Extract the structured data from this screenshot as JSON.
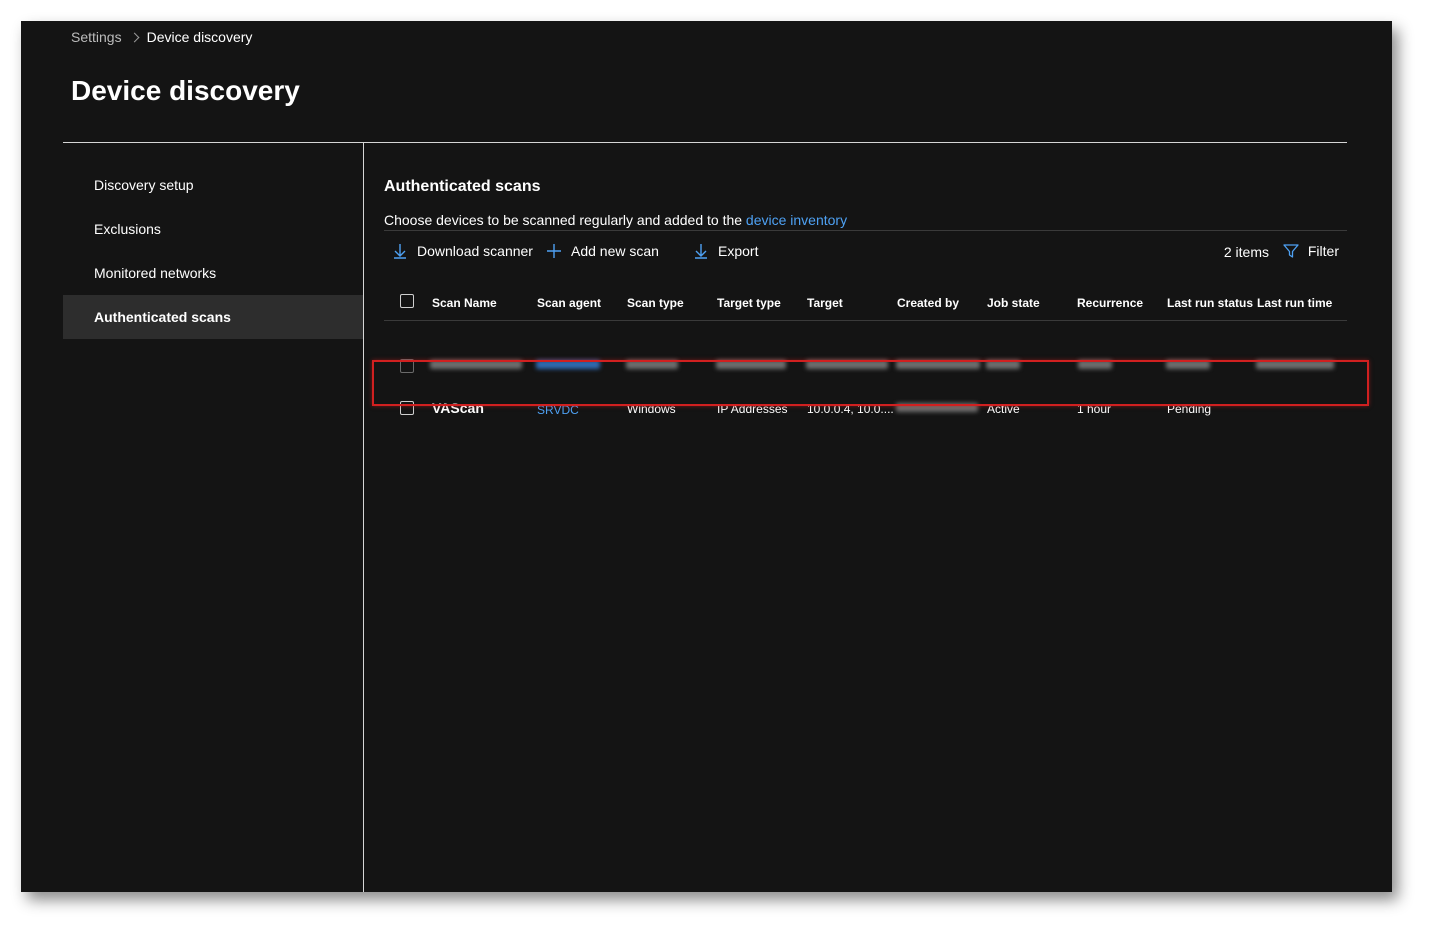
{
  "breadcrumb": {
    "parent": "Settings",
    "current": "Device discovery"
  },
  "page": {
    "title": "Device discovery"
  },
  "sidebar": {
    "items": [
      {
        "label": "Discovery setup",
        "active": false
      },
      {
        "label": "Exclusions",
        "active": false
      },
      {
        "label": "Monitored networks",
        "active": false
      },
      {
        "label": "Authenticated scans",
        "active": true
      }
    ]
  },
  "section": {
    "title": "Authenticated scans",
    "description": "Choose devices to be scanned regularly and added to the ",
    "description_link": "device inventory"
  },
  "toolbar": {
    "download_label": "Download scanner",
    "add_label": "Add new scan",
    "export_label": "Export",
    "count": "2 items",
    "filter_label": "Filter"
  },
  "table": {
    "columns": [
      "Scan Name",
      "Scan agent",
      "Scan type",
      "Target type",
      "Target",
      "Created by",
      "Job state",
      "Recurrence",
      "Last run status",
      "Last run time"
    ],
    "rows": [
      {
        "scan_name": "VAScan",
        "scan_agent": "SRVDC",
        "scan_type": "Windows",
        "target_type": "IP Addresses",
        "target": "10.0.0.4, 10.0....",
        "job_state": "Active",
        "recurrence": "1 hour",
        "last_run_status": "Pending",
        "last_run_time": ""
      }
    ]
  },
  "colors": {
    "accent": "#4ea1f3",
    "highlight": "#d12020",
    "background": "#141414"
  },
  "icons": {
    "download": "download-arrow-icon",
    "add": "plus-icon",
    "export": "export-arrow-icon",
    "filter": "filter-funnel-icon",
    "breadcrumb_sep": "chevron-right-icon"
  }
}
